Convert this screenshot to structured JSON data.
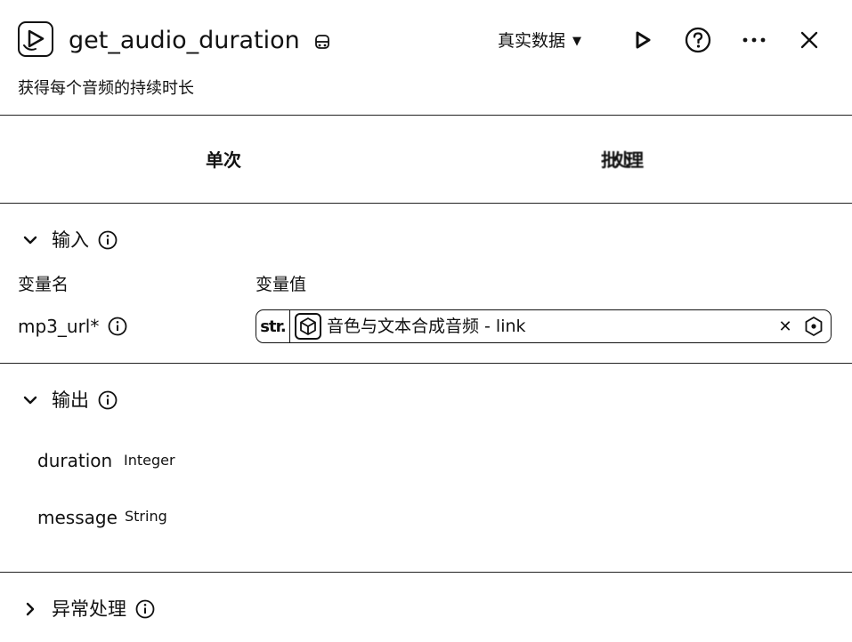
{
  "header": {
    "title": "get_audio_duration",
    "data_source": "真实数据",
    "icons": {
      "app": "video-play-icon",
      "plugin": "plugin-icon",
      "run": "play-icon",
      "help": "help-icon",
      "more": "more-icon",
      "close": "close-icon"
    }
  },
  "subtitle": "获得每个音频的持续时长",
  "tabs": {
    "single": "单次",
    "batch": "批处理"
  },
  "input_section": {
    "title": "输入",
    "col_name": "变量名",
    "col_value": "变量值",
    "variables": [
      {
        "name": "mp3_url*",
        "type_tag": "str.",
        "value": "音色与文本合成音频 - link"
      }
    ]
  },
  "output_section": {
    "title": "输出",
    "fields": [
      {
        "name": "duration",
        "type": "Integer"
      },
      {
        "name": "message",
        "type": "String"
      }
    ]
  },
  "error_section": {
    "title": "异常处理"
  }
}
